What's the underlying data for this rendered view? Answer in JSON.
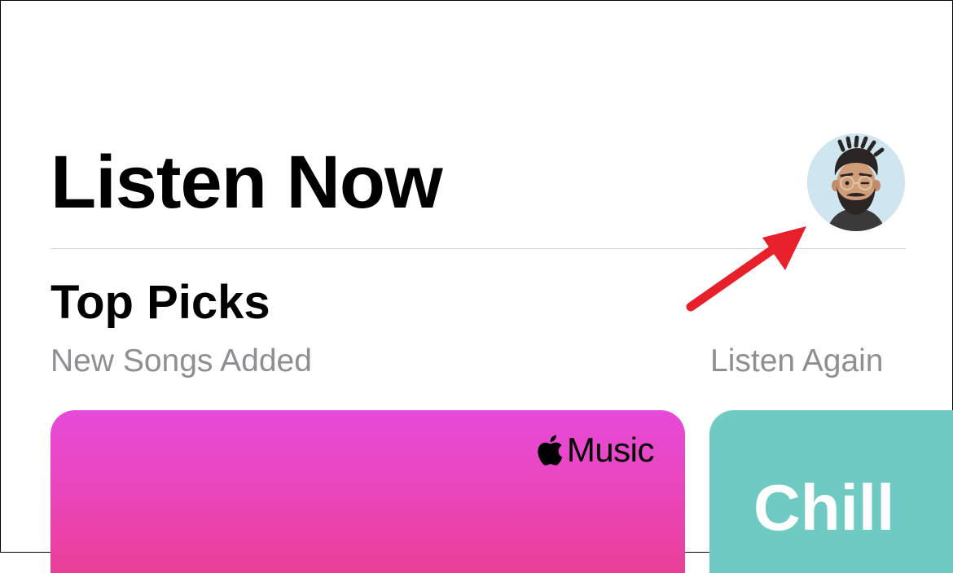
{
  "header": {
    "title": "Listen Now"
  },
  "section": {
    "title": "Top Picks",
    "subtitle": "New Songs Added",
    "secondary_subtitle": "Listen Again"
  },
  "cards": [
    {
      "brand_label": "Music",
      "brand_icon": "apple-logo-icon",
      "color": "#e648c6"
    },
    {
      "label": "Chill",
      "color": "#6ecac2"
    }
  ],
  "annotation": {
    "arrow_color": "#e8202a",
    "points_to": "profile-avatar"
  }
}
